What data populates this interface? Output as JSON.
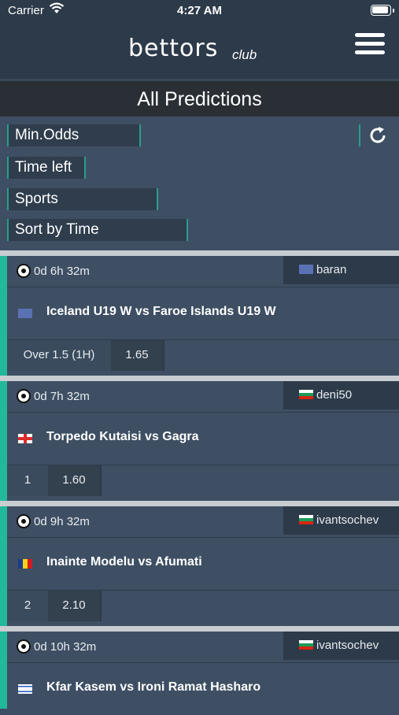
{
  "status": {
    "carrier": "Carrier",
    "time": "4:27 AM"
  },
  "brand": {
    "word": "bettors",
    "sub": "club"
  },
  "page": {
    "title": "All Predictions"
  },
  "filters": {
    "min_odds": "Min.Odds",
    "time_left": "Time left",
    "sports": "Sports",
    "sort": "Sort by Time"
  },
  "predictions": [
    {
      "time_left": "0d 6h 32m",
      "user": "baran",
      "user_flag": "eu",
      "match": "Iceland U19 W vs Faroe Islands U19 W",
      "match_flag": "eu",
      "pick": "Over 1.5 (1H)",
      "odds": "1.65"
    },
    {
      "time_left": "0d 7h 32m",
      "user": "deni50",
      "user_flag": "bg",
      "match": "Torpedo Kutaisi vs Gagra",
      "match_flag": "ge",
      "pick": "1",
      "odds": "1.60"
    },
    {
      "time_left": "0d 9h 32m",
      "user": "ivantsochev",
      "user_flag": "bg",
      "match": "Inainte Modelu vs Afumati",
      "match_flag": "ro",
      "pick": "2",
      "odds": "2.10"
    },
    {
      "time_left": "0d 10h 32m",
      "user": "ivantsochev",
      "user_flag": "bg",
      "match": "Kfar Kasem vs Ironi Ramat Hasharo",
      "match_flag": "il",
      "pick": "",
      "odds": ""
    }
  ]
}
